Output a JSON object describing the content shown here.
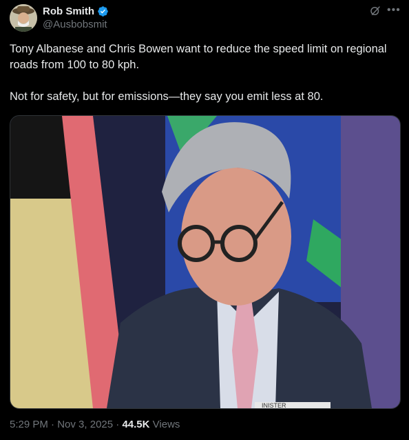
{
  "author": {
    "name": "Rob Smith",
    "handle": "@Ausbobsmit",
    "verified": true,
    "avatar_icon": "avatar-photo"
  },
  "header_icons": [
    "grok-icon",
    "more-icon"
  ],
  "tweet": {
    "text": "Tony Albanese and Chris Bowen want to reduce the speed limit on regional roads from 100 to 80 kph.\n\nNot for safety, but for emissions—they say you emit less at 80."
  },
  "media": {
    "type": "photo",
    "caption_fragment": "INISTER"
  },
  "meta": {
    "time": "5:29 PM",
    "separator": "·",
    "date": "Nov 3, 2025",
    "views_count": "44.5K",
    "views_label": "Views"
  },
  "colors": {
    "background": "#000000",
    "text": "#e7e9ea",
    "secondary": "#71767b",
    "verified": "#1d9bf0"
  }
}
